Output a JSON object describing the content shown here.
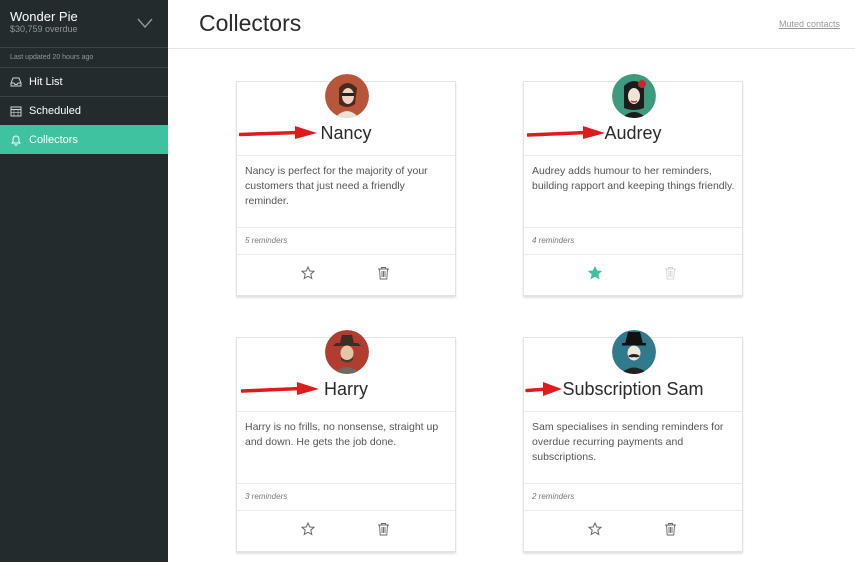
{
  "sidebar": {
    "org_name": "Wonder Pie",
    "org_overdue": "$30,759 overdue",
    "last_updated": "Last updated 20 hours ago",
    "items": [
      {
        "label": "Hit List",
        "icon": "inbox-icon"
      },
      {
        "label": "Scheduled",
        "icon": "calendar-icon"
      },
      {
        "label": "Collectors",
        "icon": "bell-icon",
        "active": true
      }
    ]
  },
  "header": {
    "title": "Collectors",
    "muted_link": "Muted contacts"
  },
  "collectors": [
    {
      "name": "Nancy",
      "description": "Nancy is perfect for the majority of your customers that just need a friendly reminder.",
      "reminders": "5 reminders",
      "starred": false,
      "trash_enabled": true
    },
    {
      "name": "Audrey",
      "description": "Audrey adds humour to her reminders, building rapport and keeping things friendly.",
      "reminders": "4 reminders",
      "starred": true,
      "trash_enabled": false
    },
    {
      "name": "Harry",
      "description": "Harry is no frills, no nonsense, straight up and down. He gets the job done.",
      "reminders": "3 reminders",
      "starred": false,
      "trash_enabled": true
    },
    {
      "name": "Subscription Sam",
      "description": "Sam specialises in sending reminders for overdue recurring payments and subscriptions.",
      "reminders": "2 reminders",
      "starred": false,
      "trash_enabled": true
    }
  ],
  "colors": {
    "sidebar_bg": "#232b2d",
    "accent": "#3ec2a0",
    "arrow": "#e01b1b"
  }
}
